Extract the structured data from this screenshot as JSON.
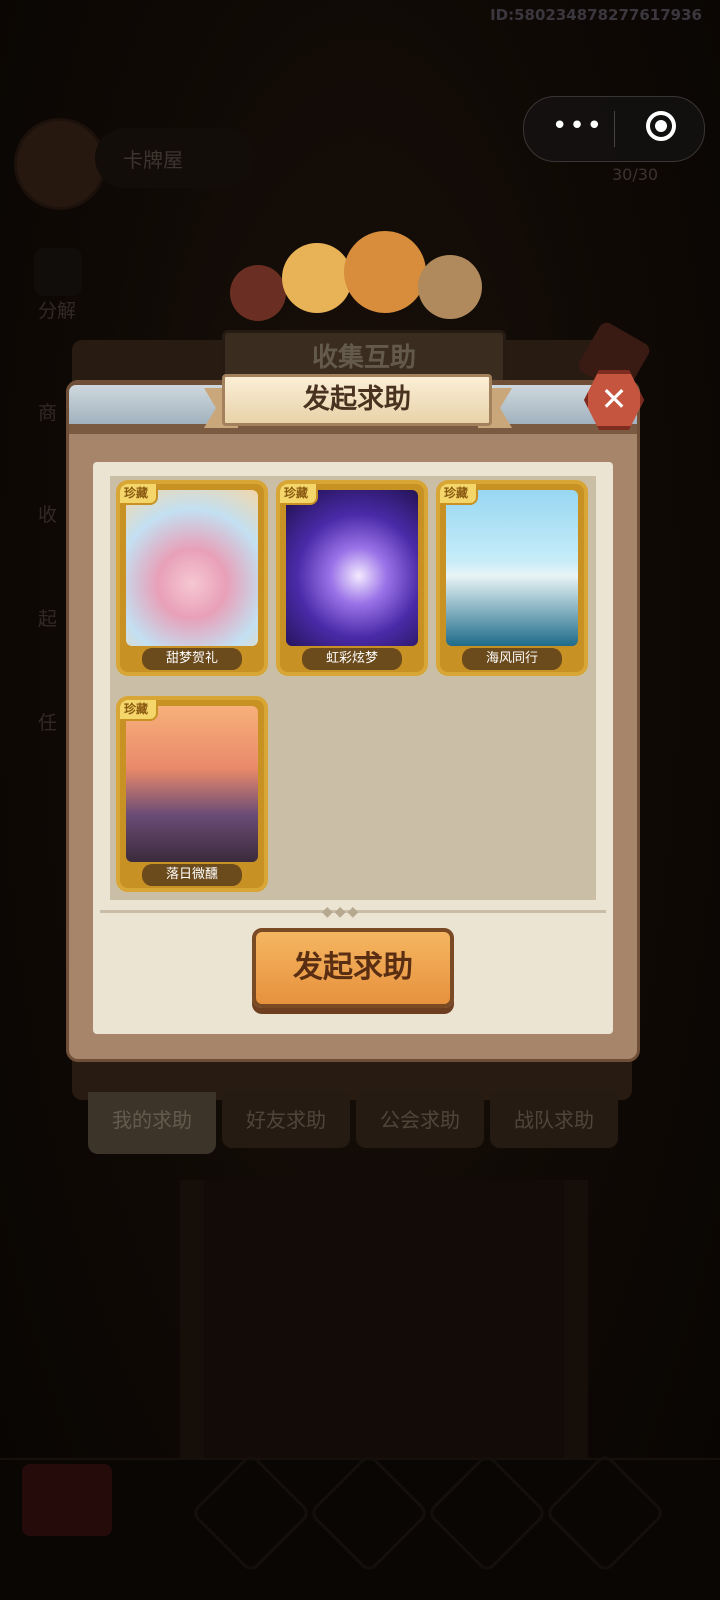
{
  "top_id": "ID:580234878277617936",
  "hud": {
    "player_name": "卡牌屋",
    "count": "30/30"
  },
  "side_menu": {
    "items": [
      "分解",
      "商",
      "收",
      "起",
      "任"
    ]
  },
  "back_panel": {
    "title": "收集互助",
    "tabs": [
      "我的求助",
      "好友求助",
      "公会求助",
      "战队求助"
    ],
    "active_tab": "我的求助"
  },
  "dialog": {
    "title": "发起求助",
    "close": "✕",
    "cards": [
      {
        "badge": "珍藏",
        "name": "甜梦贺礼"
      },
      {
        "badge": "珍藏",
        "name": "虹彩炫梦"
      },
      {
        "badge": "珍藏",
        "name": "海风同行"
      },
      {
        "badge": "珍藏",
        "name": "落日微醺"
      }
    ],
    "cta_label": "发起求助"
  },
  "colors": {
    "accent_button": "#e7913d",
    "card_border": "#d8a635",
    "close_button": "#c6553f"
  }
}
